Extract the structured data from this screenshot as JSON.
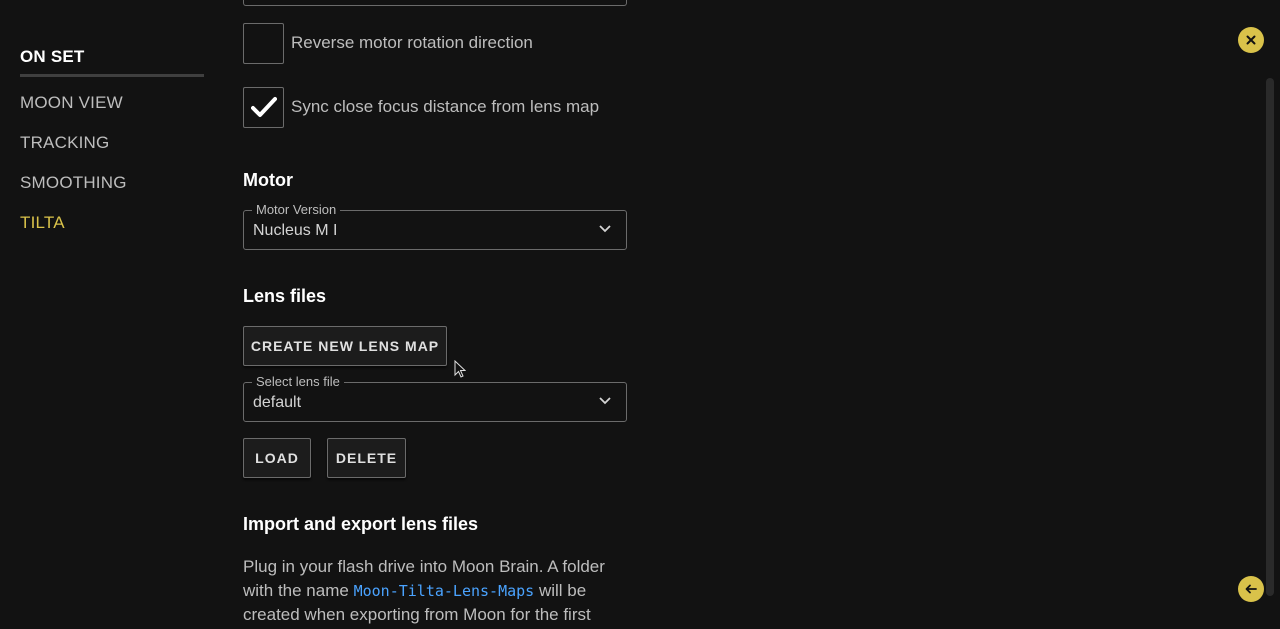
{
  "sidebar": {
    "items": [
      {
        "label": "ON SET"
      },
      {
        "label": "MOON VIEW"
      },
      {
        "label": "TRACKING"
      },
      {
        "label": "SMOOTHING"
      },
      {
        "label": "TILTA"
      }
    ]
  },
  "checkboxes": [
    {
      "label": "Reverse motor rotation direction",
      "checked": false
    },
    {
      "label": "Sync close focus distance from lens map",
      "checked": true
    }
  ],
  "motor": {
    "title": "Motor",
    "version_label": "Motor Version",
    "version_value": "Nucleus M I"
  },
  "lens_files": {
    "title": "Lens files",
    "create_label": "CREATE NEW LENS MAP",
    "select_label": "Select lens file",
    "select_value": "default",
    "load_label": "LOAD",
    "delete_label": "DELETE"
  },
  "import_export": {
    "title": "Import and export lens files",
    "text_1": "Plug in your flash drive into Moon Brain. A folder with the name",
    "code": "Moon-Tilta-Lens-Maps",
    "text_2": "will be created when exporting from Moon for the first"
  },
  "colors": {
    "background": "#121212",
    "accent": "#d9c24a",
    "link": "#4aa3ff"
  },
  "icons": {
    "close": "close-icon",
    "back": "arrow-left-icon",
    "chevron": "chevron-down-icon",
    "check": "check-icon"
  }
}
